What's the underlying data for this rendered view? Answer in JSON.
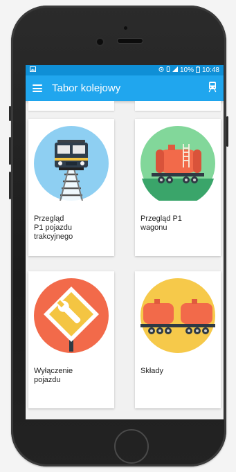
{
  "status": {
    "signal_battery": "10%",
    "time": "10:48"
  },
  "appbar": {
    "title": "Tabor kolejowy"
  },
  "cards": [
    {
      "line1": "Przegląd",
      "line2": "P1 pojazdu",
      "line3": "trakcyjnego"
    },
    {
      "line1": "Przegląd P1",
      "line2": "wagonu"
    },
    {
      "line1": "Wyłączenie",
      "line2": "pojazdu"
    },
    {
      "line1": "Składy"
    }
  ],
  "colors": {
    "appbar": "#20a6ee",
    "statusbar": "#0f8fd6"
  }
}
